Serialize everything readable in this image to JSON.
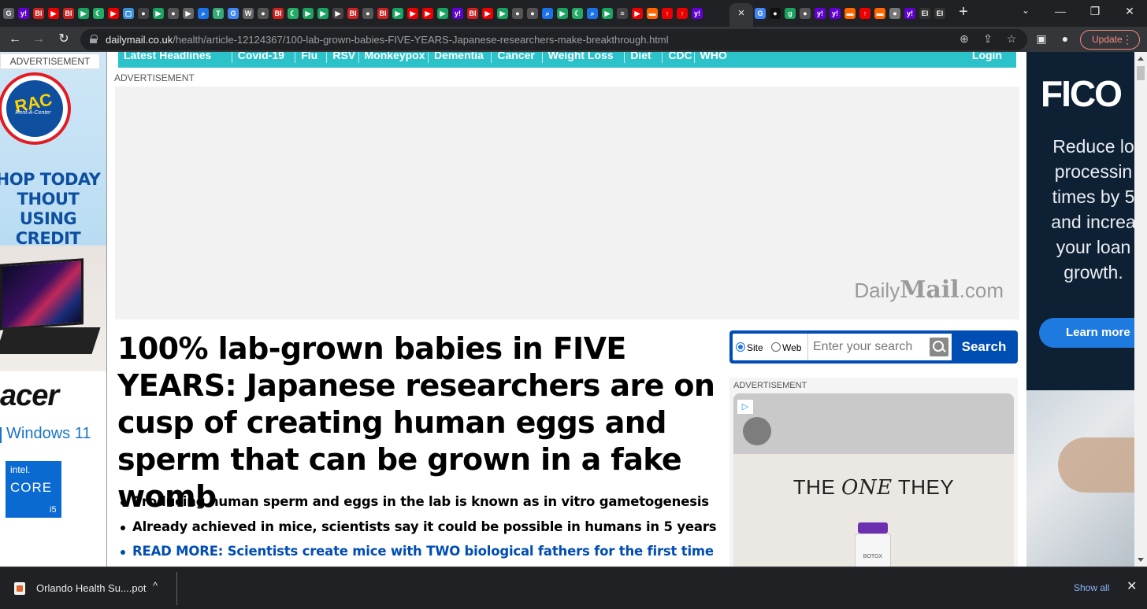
{
  "browser": {
    "active_tab_close": "×",
    "new_tab": "+",
    "window_controls": {
      "minimize": "—",
      "maximize": "❐",
      "close": "✕",
      "tab_search": "⌄"
    },
    "url_host": "dailymail.co.uk",
    "url_path": "/health/article-12124367/100-lab-grown-babies-FIVE-YEARS-Japanese-researchers-make-breakthrough.html",
    "update_label": "Update",
    "update_menu": "⋮",
    "nav": {
      "back": "←",
      "forward": "→",
      "reload": "↻"
    },
    "omnibox_icons": {
      "zoom": "⊕",
      "share": "⇪",
      "bookmark": "☆"
    },
    "toolbar_icons": {
      "sidepanel": "▣",
      "profile": "●"
    },
    "favicons": [
      {
        "label": "G",
        "color": "#5f6368"
      },
      {
        "label": "y!",
        "color": "#6001d2"
      },
      {
        "label": "BI",
        "color": "#c22"
      },
      {
        "label": "▶",
        "color": "#e00"
      },
      {
        "label": "BI",
        "color": "#c22"
      },
      {
        "label": "▶",
        "color": "#1aa260"
      },
      {
        "label": "☾",
        "color": "#2a6"
      },
      {
        "label": "▶",
        "color": "#e00"
      },
      {
        "label": "▢",
        "color": "#3a8fd8"
      },
      {
        "label": "●",
        "color": "#444"
      },
      {
        "label": "▶",
        "color": "#1aa260"
      },
      {
        "label": "●",
        "color": "#555"
      },
      {
        "label": "▶",
        "color": "#666"
      },
      {
        "label": "⌕",
        "color": "#1a73e8"
      },
      {
        "label": "T",
        "color": "#3a7"
      },
      {
        "label": "G",
        "color": "#4285f4"
      },
      {
        "label": "W",
        "color": "#666"
      },
      {
        "label": "●",
        "color": "#555"
      },
      {
        "label": "BI",
        "color": "#c22"
      },
      {
        "label": "☾",
        "color": "#2a6"
      },
      {
        "label": "▶",
        "color": "#1aa260"
      },
      {
        "label": "▶",
        "color": "#1aa260"
      },
      {
        "label": "▶",
        "color": "#444"
      },
      {
        "label": "BI",
        "color": "#c22"
      },
      {
        "label": "●",
        "color": "#555"
      },
      {
        "label": "BI",
        "color": "#c22"
      },
      {
        "label": "▶",
        "color": "#1aa260"
      },
      {
        "label": "▶",
        "color": "#e00"
      },
      {
        "label": "▶",
        "color": "#e00"
      },
      {
        "label": "▶",
        "color": "#1aa260"
      },
      {
        "label": "y!",
        "color": "#6001d2"
      },
      {
        "label": "BI",
        "color": "#c22"
      },
      {
        "label": "▶",
        "color": "#e00"
      },
      {
        "label": "▶",
        "color": "#1aa260"
      },
      {
        "label": "●",
        "color": "#555"
      },
      {
        "label": "●",
        "color": "#555"
      },
      {
        "label": "⌕",
        "color": "#1a73e8"
      },
      {
        "label": "▶",
        "color": "#1aa260"
      },
      {
        "label": "☾",
        "color": "#2a6"
      },
      {
        "label": "⌕",
        "color": "#1a73e8"
      },
      {
        "label": "▶",
        "color": "#1aa260"
      },
      {
        "label": "≡",
        "color": "#444"
      },
      {
        "label": "▶",
        "color": "#e00"
      },
      {
        "label": "▬",
        "color": "#f60"
      },
      {
        "label": "↑",
        "color": "#e00"
      },
      {
        "label": "↑",
        "color": "#e00"
      },
      {
        "label": "y!",
        "color": "#6001d2"
      }
    ],
    "favicons_after": [
      {
        "label": "G",
        "color": "#4285f4"
      },
      {
        "label": "●",
        "color": "#111"
      },
      {
        "label": "g",
        "color": "#1aa260"
      },
      {
        "label": "●",
        "color": "#555"
      },
      {
        "label": "y!",
        "color": "#6001d2"
      },
      {
        "label": "y!",
        "color": "#6001d2"
      },
      {
        "label": "▬",
        "color": "#f60"
      },
      {
        "label": "↑",
        "color": "#e00"
      },
      {
        "label": "▬",
        "color": "#f60"
      },
      {
        "label": "●",
        "color": "#777"
      },
      {
        "label": "y!",
        "color": "#6001d2"
      },
      {
        "label": "EI",
        "color": "#333"
      },
      {
        "label": "EI",
        "color": "#333"
      }
    ]
  },
  "nav": {
    "items": [
      "Latest Headlines",
      "Covid-19",
      "Flu",
      "RSV",
      "Monkeypox",
      "Dementia",
      "Cancer",
      "Weight Loss",
      "Diet",
      "CDC",
      "WHO"
    ],
    "login": "Login"
  },
  "ads": {
    "label": "ADVERTISEMENT",
    "left": {
      "brand_top": "RAC",
      "brand_sub": "Rent-A-Center",
      "promo": "HOP TODAY\nTHOUT USING\nCREDIT",
      "acer": "acer",
      "windows": "Windows 11",
      "intel_line1": "intel.",
      "intel_line2": "CORE",
      "intel_line3": "i5"
    },
    "top_banner_logo_a": "Daily",
    "top_banner_logo_b": "Mail",
    "top_banner_logo_c": ".com",
    "mpu": {
      "adchoices": "▷",
      "tagline_a": "THE ",
      "tagline_b": "ONE",
      "tagline_c": " THEY",
      "vial_text": "BOTOX"
    },
    "fico": {
      "logo": "FICO",
      "copy": "Reduce lo\nprocessin\ntimes by 5\nand increa\nyour loan\ngrowth.",
      "cta": "Learn more"
    }
  },
  "article": {
    "headline": "100% lab-grown babies in FIVE YEARS: Japanese researchers are on cusp of creating human eggs and sperm that can be grown in a fake womb",
    "bullets": [
      "Producing human sperm and eggs in the lab is known as in vitro gametogenesis",
      "Already achieved in mice, scientists say it could be possible in humans in 5 years"
    ],
    "read_more": "READ MORE: Scientists create mice with TWO biological fathers for the first time"
  },
  "search": {
    "option_site": "Site",
    "option_web": "Web",
    "placeholder": "Enter your search",
    "button": "Search"
  },
  "downloads": {
    "file": "Orlando Health Su....pot",
    "caret": "^",
    "show_all": "Show all",
    "close": "✕"
  },
  "colors": {
    "nav_teal": "#2cc2ca",
    "search_blue": "#004db3",
    "link_blue": "#004db3",
    "fico_navy": "#0e2033"
  }
}
